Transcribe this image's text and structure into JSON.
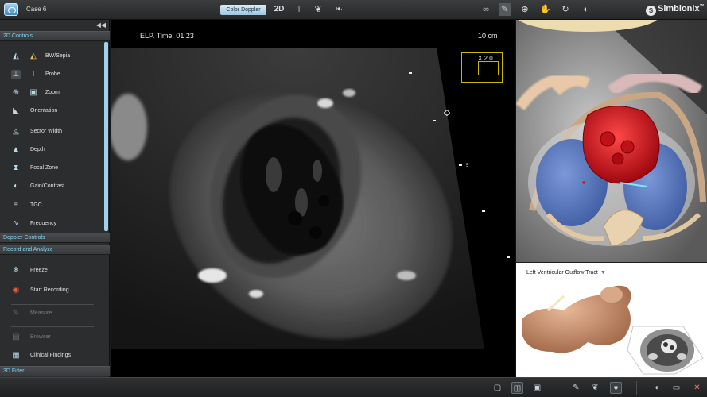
{
  "topbar": {
    "case_label": "Case 6",
    "mode_button": "Color Doppler",
    "dim_label": "2D",
    "brand": "Simbionix"
  },
  "left_panel": {
    "section_2d": "2D Controls",
    "controls": [
      {
        "label": "BW/Sepia",
        "icon": "bw-sepia-icon"
      },
      {
        "label": "Probe",
        "icon": "probe-icon"
      },
      {
        "label": "Zoom",
        "icon": "zoom-icon"
      },
      {
        "label": "Orientation",
        "icon": "orientation-icon"
      },
      {
        "label": "Sector Width",
        "icon": "sector-width-icon"
      },
      {
        "label": "Depth",
        "icon": "depth-icon"
      },
      {
        "label": "Focal Zone",
        "icon": "focal-zone-icon"
      },
      {
        "label": "Gain/Contrast",
        "icon": "gain-contrast-icon"
      },
      {
        "label": "TGC",
        "icon": "tgc-icon"
      },
      {
        "label": "Frequency",
        "icon": "frequency-icon"
      }
    ],
    "section_doppler": "Doppler Controls",
    "section_record": "Record and Analyze",
    "record_items": [
      {
        "label": "Freeze",
        "icon": "freeze-icon",
        "enabled": true
      },
      {
        "label": "Start Recording",
        "icon": "record-icon",
        "enabled": true
      },
      {
        "label": "Measure",
        "icon": "measure-icon",
        "enabled": false
      },
      {
        "label": "Browser",
        "icon": "browser-icon",
        "enabled": false
      },
      {
        "label": "Clinical Findings",
        "icon": "clinical-findings-icon",
        "enabled": true
      }
    ],
    "section_3d": "3D Filter"
  },
  "viewport": {
    "elapsed_time": "ELP. Time: 01:23",
    "depth": "10 cm",
    "zoom": "X 2.0",
    "scale_mark": "5"
  },
  "anatomy": {
    "view_name": "Left Ventricular Outflow Tract"
  },
  "colors": {
    "accent": "#7fd3f3",
    "heart_red": "#d0141c",
    "chamber_blue": "#5a7fc4"
  }
}
